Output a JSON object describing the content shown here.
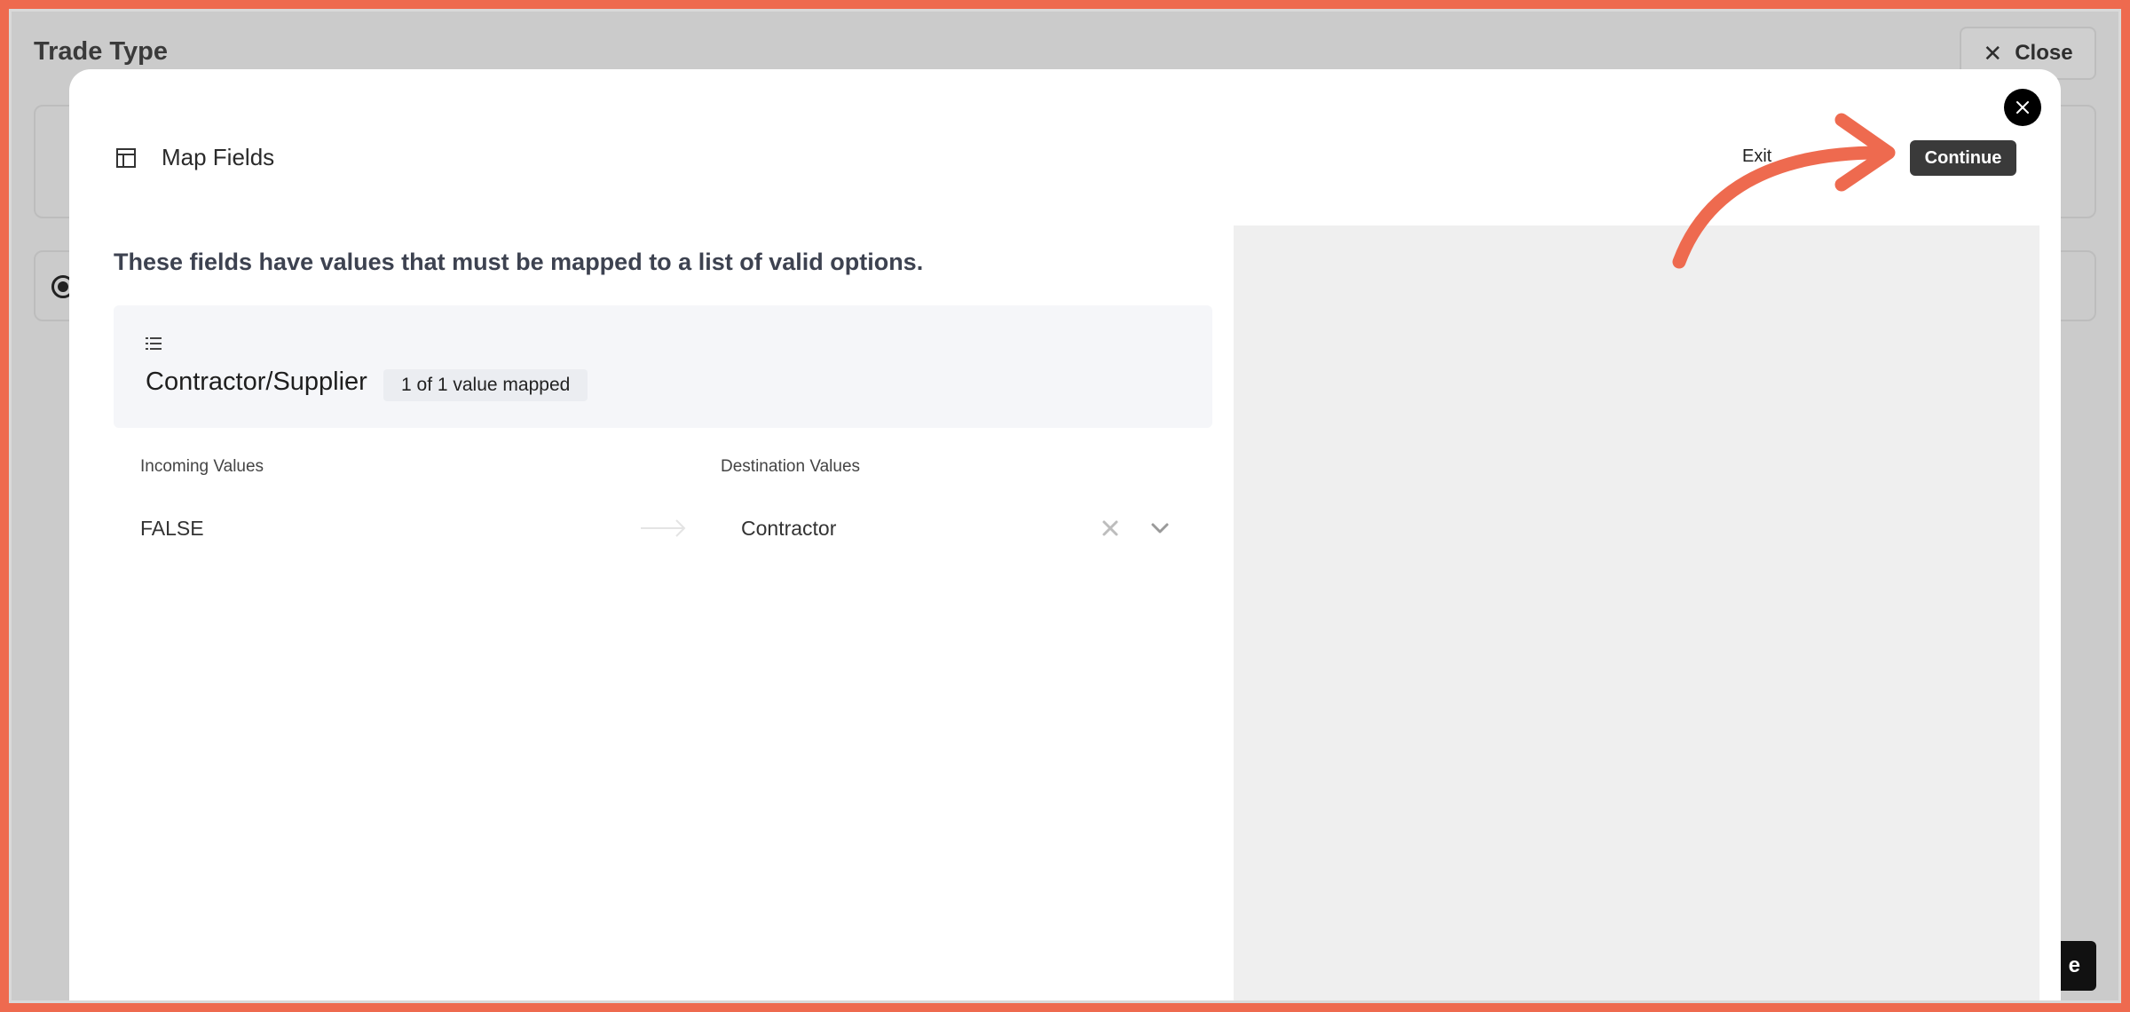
{
  "background": {
    "title": "Trade Type",
    "close_label": "Close",
    "bottom_button_fragment": "e"
  },
  "modal": {
    "header": {
      "icon": "table-icon",
      "title": "Map Fields",
      "exit_label": "Exit",
      "continue_label": "Continue"
    },
    "instruction": "These fields have values that must be mapped to a list of valid options.",
    "field": {
      "icon": "list-icon",
      "name": "Contractor/Supplier",
      "mapped_badge": "1 of 1 value mapped"
    },
    "columns": {
      "incoming": "Incoming Values",
      "destination": "Destination Values"
    },
    "rows": [
      {
        "incoming": "FALSE",
        "destination": "Contractor"
      }
    ]
  },
  "colors": {
    "annotation": "#ee6a4f",
    "continue_button": "#3a3a3a",
    "preview_pane": "#efefef"
  }
}
